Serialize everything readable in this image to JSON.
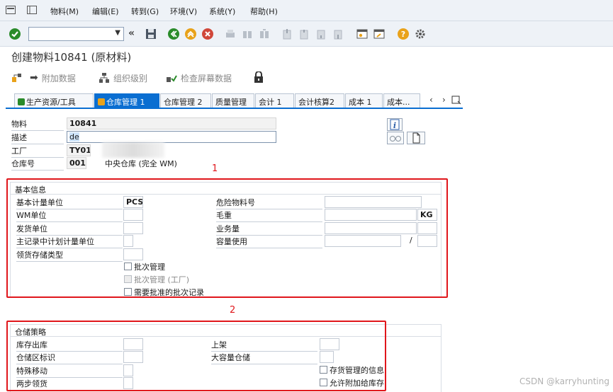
{
  "menubar": {
    "items": [
      {
        "label": "物料(M)"
      },
      {
        "label": "编辑(E)"
      },
      {
        "label": "转到(G)"
      },
      {
        "label": "环境(V)"
      },
      {
        "label": "系统(Y)"
      },
      {
        "label": "帮助(H)"
      }
    ]
  },
  "toolbar": {
    "command_field_value": "",
    "colors": {
      "enter": "#2a8b2a",
      "nav": "#e8a21a",
      "cancel": "#d0473a",
      "help": "#e9a21a"
    }
  },
  "title": "创建物料10841 (原材料)",
  "app_toolbar": {
    "additional_data": "附加数据",
    "org_levels": "组织级别",
    "check_screen_data": "检查屏幕数据"
  },
  "tabs": [
    {
      "label": "生产资源/工具"
    },
    {
      "label": "仓库管理 1"
    },
    {
      "label": "仓库管理 2"
    },
    {
      "label": "质量管理"
    },
    {
      "label": "会计 1"
    },
    {
      "label": "会计核算2"
    },
    {
      "label": "成本 1"
    },
    {
      "label": "成本..."
    }
  ],
  "header": {
    "material_label": "物料",
    "material_value": "10841",
    "description_label": "描述",
    "description_value": "de",
    "plant_label": "工厂",
    "plant_value": "TY01",
    "warehouse_label": "仓库号",
    "warehouse_value": "001",
    "warehouse_desc": "中央仓库 (完全 WM)"
  },
  "basic": {
    "title": "基本信息",
    "base_uom_label": "基本计量单位",
    "base_uom_value": "PCS",
    "wm_unit_label": "WM单位",
    "issue_unit_label": "发货单位",
    "planned_unit_label": "主记录中计划计量单位",
    "picking_storage_label": "领货存储类型",
    "hazmat_label": "危险物料号",
    "gross_weight_label": "毛重",
    "gross_weight_unit": "KG",
    "volume_label": "业务量",
    "capacity_label": "容量使用",
    "capacity_sep": "/",
    "batch_mgmt": "批次管理",
    "batch_mgmt_plant": "批次管理 (工厂)",
    "approved_batch": "需要批准的批次记录"
  },
  "storage": {
    "title": "仓储策略",
    "removal_label": "库存出库",
    "section_label": "仓储区标识",
    "special_move_label": "特殊移动",
    "two_step_label": "两步领货",
    "placement_label": "上架",
    "bulk_label": "大容量仓储",
    "stock_info": "存货管理的信息",
    "allow_add": "允许附加给库存"
  },
  "annotations": {
    "box1": "1",
    "box2": "2"
  },
  "watermark": "CSDN @karryhunting"
}
